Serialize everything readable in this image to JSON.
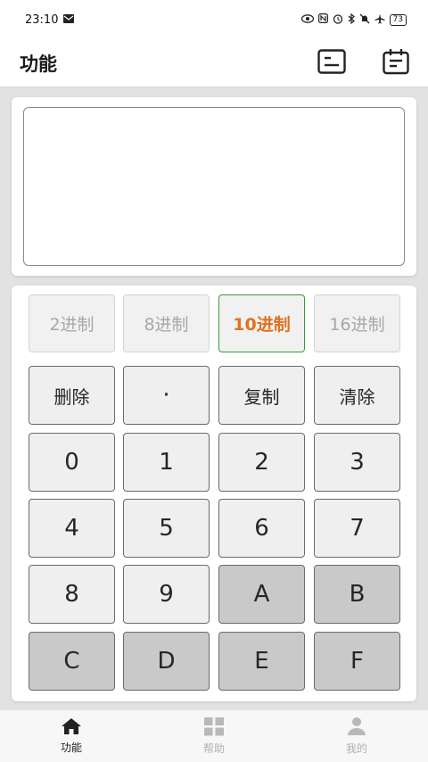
{
  "status_bar": {
    "time": "23:10",
    "battery": "73"
  },
  "appbar": {
    "title": "功能"
  },
  "base_tabs": [
    {
      "label": "2进制",
      "active": false
    },
    {
      "label": "8进制",
      "active": false
    },
    {
      "label": "10进制",
      "active": true
    },
    {
      "label": "16进制",
      "active": false
    }
  ],
  "keys": {
    "delete": "删除",
    "dot": "·",
    "copy": "复制",
    "clear": "清除",
    "k0": "0",
    "k1": "1",
    "k2": "2",
    "k3": "3",
    "k4": "4",
    "k5": "5",
    "k6": "6",
    "k7": "7",
    "k8": "8",
    "k9": "9",
    "kA": "A",
    "kB": "B",
    "kC": "C",
    "kD": "D",
    "kE": "E",
    "kF": "F"
  },
  "bottom_nav": {
    "features": "功能",
    "help": "帮助",
    "mine": "我的"
  },
  "colors": {
    "active_base_text": "#e0711e",
    "active_base_border": "#3a9a3a",
    "hex_key_bg": "#c9c9c9",
    "key_bg": "#efefef"
  }
}
